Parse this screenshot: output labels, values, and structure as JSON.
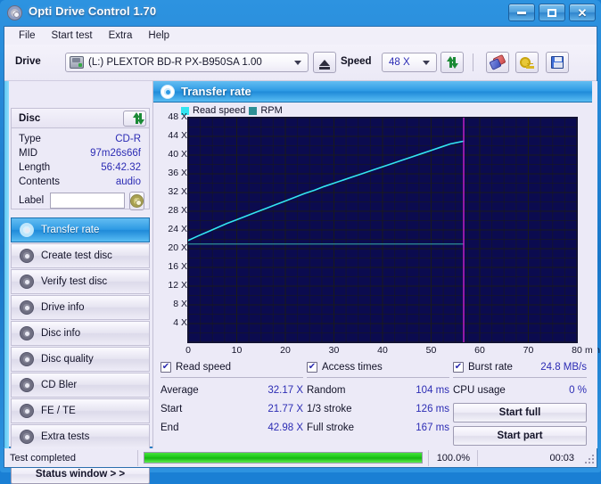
{
  "window": {
    "title": "Opti Drive Control 1.70",
    "icon": "cd-disc-icon",
    "minimize": "–",
    "maximize": "□",
    "close": "✕"
  },
  "menu": {
    "items": [
      "File",
      "Start test",
      "Extra",
      "Help"
    ]
  },
  "toolbar": {
    "drive_label": "Drive",
    "drive_value": "(L:)  PLEXTOR BD-R  PX-B950SA 1.00",
    "eject_title": "Eject",
    "speed_label": "Speed",
    "speed_value": "48 X",
    "refresh_title": "Refresh",
    "erase_title": "Erase",
    "keys_title": "Keys",
    "save_title": "Save"
  },
  "disc": {
    "header": "Disc",
    "rows": [
      {
        "key": "Type",
        "value": "CD-R"
      },
      {
        "key": "MID",
        "value": "97m26s66f"
      },
      {
        "key": "Length",
        "value": "56:42.32"
      },
      {
        "key": "Contents",
        "value": "audio"
      }
    ],
    "label_key": "Label",
    "label_value": "",
    "label_placeholder": ""
  },
  "sidebar": {
    "items": [
      {
        "label": "Transfer rate",
        "active": true
      },
      {
        "label": "Create test disc",
        "active": false
      },
      {
        "label": "Verify test disc",
        "active": false
      },
      {
        "label": "Drive info",
        "active": false
      },
      {
        "label": "Disc info",
        "active": false
      },
      {
        "label": "Disc quality",
        "active": false
      },
      {
        "label": "CD Bler",
        "active": false
      },
      {
        "label": "FE / TE",
        "active": false
      },
      {
        "label": "Extra tests",
        "active": false
      }
    ],
    "status_window": "Status window > >"
  },
  "main": {
    "title": "Transfer rate"
  },
  "chart_data": {
    "type": "line",
    "title": "Transfer rate",
    "xlabel": "min",
    "ylabel": "X",
    "xlim": [
      0,
      80
    ],
    "ylim": [
      0,
      48
    ],
    "xticks": [
      0,
      10,
      20,
      30,
      40,
      50,
      60,
      70,
      80
    ],
    "xtick_labels": [
      "0",
      "10",
      "20",
      "30",
      "40",
      "50",
      "60",
      "70",
      "80"
    ],
    "x_unit": "min",
    "yticks": [
      4,
      8,
      12,
      16,
      20,
      24,
      28,
      32,
      36,
      40,
      44,
      48
    ],
    "ytick_labels": [
      "4 X",
      "8 X",
      "12 X",
      "16 X",
      "20 X",
      "24 X",
      "28 X",
      "32 X",
      "36 X",
      "40 X",
      "44 X",
      "48 X"
    ],
    "grid": true,
    "legend_position": "top-left",
    "background": "#0b0b4f",
    "gridline_color": "#1a1a1a",
    "marker_line": {
      "x": 56.7,
      "color": "#cc22cc"
    },
    "series": [
      {
        "name": "Read speed",
        "color": "#33e5f0",
        "x": [
          0.0,
          2.0,
          4.0,
          6.0,
          8.0,
          10.0,
          12.0,
          14.0,
          16.0,
          18.0,
          20.0,
          22.0,
          24.0,
          26.0,
          28.0,
          30.0,
          32.0,
          34.0,
          36.0,
          38.0,
          40.0,
          42.0,
          44.0,
          46.0,
          48.0,
          50.0,
          52.0,
          54.0,
          56.7
        ],
        "values": [
          21.77,
          22.7,
          23.6,
          24.5,
          25.4,
          26.2,
          27.0,
          27.8,
          28.6,
          29.4,
          30.2,
          31.0,
          31.8,
          32.5,
          33.3,
          34.0,
          34.7,
          35.4,
          36.1,
          36.8,
          37.5,
          38.2,
          38.9,
          39.6,
          40.3,
          41.0,
          41.7,
          42.4,
          42.98
        ]
      },
      {
        "name": "RPM",
        "color": "#2e8f96",
        "x": [
          0.0,
          56.7
        ],
        "values": [
          21.0,
          21.0
        ]
      }
    ],
    "legend": [
      {
        "label": "Read speed",
        "color": "#33e5f0"
      },
      {
        "label": "RPM",
        "color": "#2e8f96"
      }
    ]
  },
  "stats": {
    "read_speed": {
      "checkbox_label": "Read speed",
      "checked": true,
      "rows": [
        {
          "key": "Average",
          "value": "32.17 X"
        },
        {
          "key": "Start",
          "value": "21.77 X"
        },
        {
          "key": "End",
          "value": "42.98 X"
        }
      ]
    },
    "access_times": {
      "checkbox_label": "Access times",
      "checked": true,
      "rows": [
        {
          "key": "Random",
          "value": "104 ms"
        },
        {
          "key": "1/3 stroke",
          "value": "126 ms"
        },
        {
          "key": "Full stroke",
          "value": "167 ms"
        }
      ]
    },
    "burst": {
      "checkbox_label": "Burst rate",
      "checked": true,
      "value": "24.8 MB/s",
      "cpu_key": "CPU usage",
      "cpu_value": "0 %",
      "start_full": "Start full",
      "start_part": "Start part"
    }
  },
  "statusbar": {
    "message": "Test completed",
    "progress_text": "100.0%",
    "progress_percent": 100,
    "elapsed": "00:03"
  }
}
